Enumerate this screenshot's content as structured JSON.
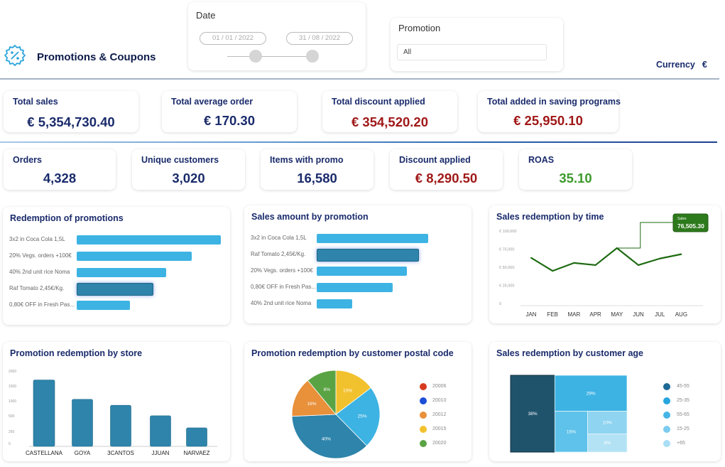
{
  "header": {
    "title": "Promotions & Coupons",
    "logo_icon": "percent-badge-icon",
    "currency_label": "Currency",
    "currency_symbol": "€"
  },
  "filters": {
    "date": {
      "label": "Date",
      "start": "01 / 01 / 2022",
      "end": "31 / 08 / 2022"
    },
    "promotion": {
      "label": "Promotion",
      "selected": "All"
    }
  },
  "kpis_row1": [
    {
      "title": "Total sales",
      "value": "€  5,354,730.40",
      "tone": "blue"
    },
    {
      "title": "Total average order",
      "value": "€  170.30",
      "tone": "blue"
    },
    {
      "title": "Total discount applied",
      "value": "€  354,520.20",
      "tone": "red"
    },
    {
      "title": "Total added in saving programs",
      "value": "€ 25,950.10",
      "tone": "red"
    }
  ],
  "kpis_row2": [
    {
      "title": "Orders",
      "value": "4,328",
      "tone": "blue"
    },
    {
      "title": "Unique customers",
      "value": "3,020",
      "tone": "blue"
    },
    {
      "title": "Items with promo",
      "value": "16,580",
      "tone": "blue"
    },
    {
      "title": "Discount applied",
      "value": "€ 8,290.50",
      "tone": "red"
    },
    {
      "title": "ROAS",
      "value": "35.10",
      "tone": "green"
    }
  ],
  "colors": {
    "primary_bar": "#3db3e3",
    "highlight_bar": "#2e84aa",
    "line": "#1e6b12",
    "store_bar": "#2e84aa",
    "navy": "#1a2b6b",
    "red": "#a01818",
    "green": "#3c9a2c"
  },
  "chart_data": [
    {
      "id": "redemption",
      "type": "bar",
      "orientation": "horizontal",
      "title": "Redemption of promotions",
      "categories": [
        "3x2 in Coca Cola 1,5L",
        "20% Vegs. orders +100€",
        "40% 2nd unit rice Noma",
        "Raf Tomato 2,45€/Kg.",
        "0,80€ OFF in Fresh Pas..."
      ],
      "values": [
        100,
        80,
        62,
        53,
        37
      ],
      "highlighted_index": 3,
      "unit": "relative"
    },
    {
      "id": "sales_by_promo",
      "type": "bar",
      "orientation": "horizontal",
      "title": "Sales amount by promotion",
      "categories": [
        "3x2 in Coca Cola 1,5L",
        "Raf Tomato 2,45€/Kg.",
        "20% Vegs. orders +100€",
        "0,80€ OFF in Fresh Pas...",
        "40% 2nd unit rice Noma"
      ],
      "values": [
        100,
        92,
        81,
        68,
        32
      ],
      "highlighted_index": 1,
      "unit": "relative"
    },
    {
      "id": "sales_time",
      "type": "line",
      "title": "Sales redemption by time",
      "x": [
        "JAN",
        "FEB",
        "MAR",
        "APR",
        "MAY",
        "JUN",
        "JUL",
        "AUG"
      ],
      "values": [
        63000,
        45000,
        56000,
        53000,
        76505.3,
        53000,
        62000,
        68000
      ],
      "yticks": [
        "0",
        "€ 25,000",
        "€ 50,000",
        "€ 75,000",
        "€ 100,000"
      ],
      "ylim": [
        0,
        100000
      ],
      "tooltip": {
        "label": "Sales",
        "value": "76,505.30",
        "index": 4
      }
    },
    {
      "id": "store",
      "type": "bar",
      "title": "Promotion redemption by store",
      "categories": [
        "CASTELLANA",
        "GOYA",
        "3CANTOS",
        "JJUAN",
        "NARVAEZ"
      ],
      "values": [
        1750,
        1100,
        900,
        550,
        330
      ],
      "yticks": [
        "0",
        "250",
        "500",
        "1000",
        "1500",
        "2000"
      ],
      "ylim": [
        0,
        2000
      ]
    },
    {
      "id": "postal",
      "type": "pie",
      "title": "Promotion redemption by customer postal code",
      "slices": [
        {
          "label": "20015",
          "value": 16,
          "text": "10%",
          "color": "#f2c12e"
        },
        {
          "label": "20010",
          "value": 25,
          "text": "25%",
          "color": "#3db3e3"
        },
        {
          "label": "",
          "value": 40,
          "text": "40%",
          "color": "#2e84aa"
        },
        {
          "label": "20012",
          "value": 16,
          "text": "16%",
          "color": "#e8903a"
        },
        {
          "label": "20020",
          "value": 12,
          "text": "8%",
          "color": "#5aa344"
        }
      ],
      "legend": [
        {
          "label": "20006",
          "color": "#d63a1e"
        },
        {
          "label": "20010",
          "color": "#1c4fd6"
        },
        {
          "label": "20012",
          "color": "#e8903a"
        },
        {
          "label": "20015",
          "color": "#f2c12e"
        },
        {
          "label": "20020",
          "color": "#5aa344"
        }
      ],
      "legend_position": "right"
    },
    {
      "id": "age",
      "type": "treemap",
      "title": "Sales redemption by customer age",
      "items": [
        {
          "label": "45-55",
          "value": 38,
          "text": "38%",
          "color": "#1f536c"
        },
        {
          "label": "25-35",
          "value": 29,
          "text": "29%",
          "color": "#3db3e3"
        },
        {
          "label": "55-65",
          "value": 15,
          "text": "15%",
          "color": "#5fc2ea"
        },
        {
          "label": "15-25",
          "value": 10,
          "text": "10%",
          "color": "#8fd4f0"
        },
        {
          "label": "+65",
          "value": 8,
          "text": "8%",
          "color": "#b3e2f5"
        }
      ],
      "legend": [
        {
          "label": "45-55",
          "color": "#1c6a96"
        },
        {
          "label": "25-35",
          "color": "#27a5df"
        },
        {
          "label": "55-65",
          "color": "#45b6e6"
        },
        {
          "label": "15-25",
          "color": "#7cccef"
        },
        {
          "label": "+65",
          "color": "#a9def5"
        }
      ],
      "legend_position": "right"
    }
  ]
}
